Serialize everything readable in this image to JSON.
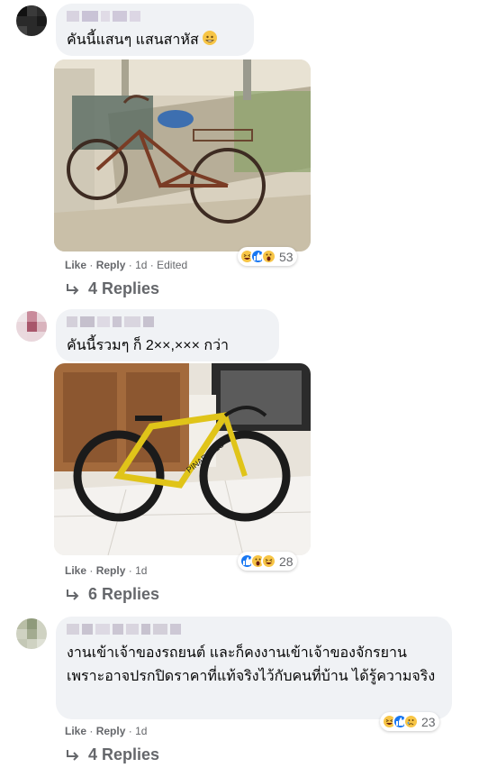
{
  "comments": [
    {
      "text": "คันนี้แสนๆ แสนสาหัส",
      "actions": {
        "like": "Like",
        "reply": "Reply",
        "time": "1d",
        "edited": "Edited"
      },
      "reactions": {
        "count": "53",
        "icons": [
          "haha-icon",
          "like-icon",
          "wow-icon"
        ]
      },
      "replies": "4 Replies"
    },
    {
      "text": "คันนี้รวมๆ ก็ 2××,××× กว่า",
      "photo_brand": "PINARELLO",
      "actions": {
        "like": "Like",
        "reply": "Reply",
        "time": "1d"
      },
      "reactions": {
        "count": "28",
        "icons": [
          "like-icon",
          "wow-icon",
          "haha-icon"
        ]
      },
      "replies": "6 Replies"
    },
    {
      "text": "งานเข้าเจ้าของรถยนต์ และก็คงงานเข้าเจ้าของจักรยาน เพราะอาจปรกปิดราคาที่แท้จริงไว้กับคนที่บ้าน ได้รู้ความจริง",
      "actions": {
        "like": "Like",
        "reply": "Reply",
        "time": "1d"
      },
      "reactions": {
        "count": "23",
        "icons": [
          "haha-icon",
          "like-icon",
          "sad-icon"
        ]
      },
      "replies": "4 Replies"
    }
  ],
  "colors": {
    "bubble": "#f0f2f5",
    "meta_text": "#65676b",
    "like_blue": "#1877f2",
    "reaction_yellow": "#f7c546"
  }
}
